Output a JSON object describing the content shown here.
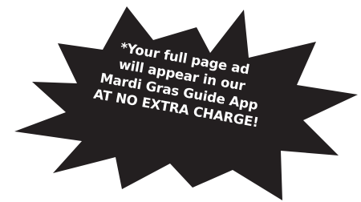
{
  "burst": {
    "fill_color": "#231f20",
    "text_color": "#ffffff",
    "lines": [
      "*Your full page ad",
      "will appear in our",
      "Mardi Gras Guide App",
      "AT NO EXTRA CHARGE!"
    ]
  }
}
